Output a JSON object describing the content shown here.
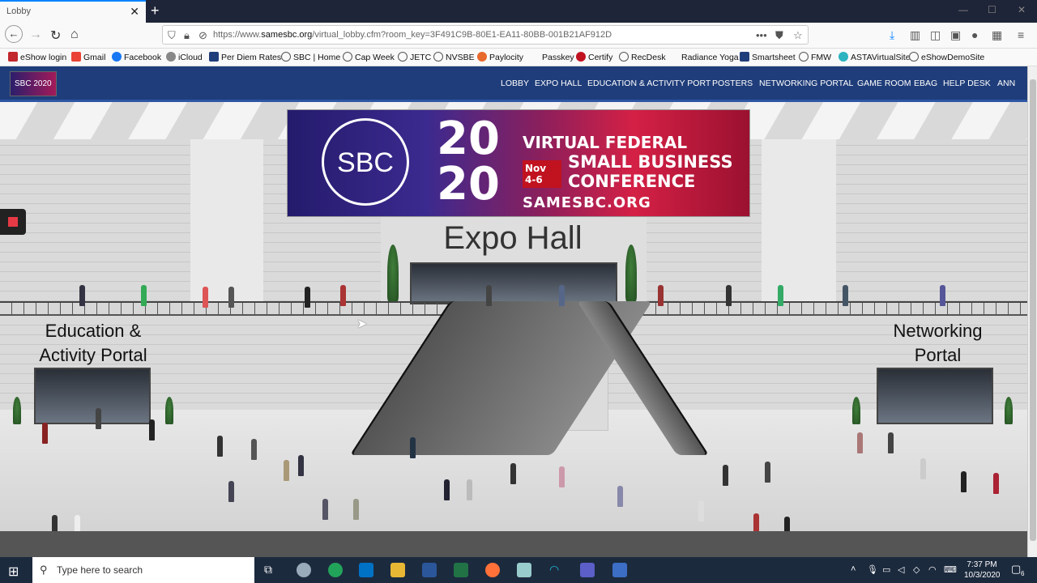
{
  "browser": {
    "tab_title": "Lobby",
    "tab_close": "✕",
    "new_tab": "+",
    "window_controls": {
      "minimize": "—",
      "maximize": "☐",
      "close": "✕"
    },
    "url_prefix": "https://www.",
    "url_domain": "samesbc.org",
    "url_path": "/virtual_lobby.cfm?room_key=3F491C9B-80E1-EA11-80BB-001B21AF912D",
    "bookmarks": [
      "eShow login",
      "Gmail",
      "Facebook",
      "iCloud",
      "Per Diem Rates",
      "SBC | Home",
      "Cap Week",
      "JETC",
      "NVSBE",
      "Paylocity",
      "Passkey",
      "Certify",
      "RecDesk",
      "Radiance Yoga",
      "Smartsheet",
      "FMW",
      "ASTAVirtualSite",
      "eShowDemoSite"
    ]
  },
  "site": {
    "logo_text": "SBC 2020",
    "nav": [
      "LOBBY",
      "EXPO HALL",
      "EDUCATION & ACTIVITY PORT",
      "POSTERS",
      "NETWORKING PORTAL",
      "GAME ROOM",
      "EBAG",
      "HELP DESK",
      "ANN"
    ]
  },
  "banner": {
    "seal": "SBC",
    "year_top": "20",
    "year_bottom": "20",
    "line1": "VIRTUAL FEDERAL",
    "line2": "SMALL BUSINESS",
    "line3": "CONFERENCE",
    "dates": "Nov 4-6",
    "site": "SAMESBC.ORG"
  },
  "lobby": {
    "expo_hall": "Expo Hall",
    "education_line1": "Education &",
    "education_line2": "Activity Portal",
    "networking_line1": "Networking",
    "networking_line2": "Portal"
  },
  "taskbar": {
    "search_placeholder": "Type here to search",
    "time": "7:37 PM",
    "date": "10/3/2020",
    "notification_count": "6"
  },
  "colors": {
    "site_nav": "#1f3d7a",
    "taskbar": "#1c2a3e",
    "accent": "#0a84ff"
  }
}
